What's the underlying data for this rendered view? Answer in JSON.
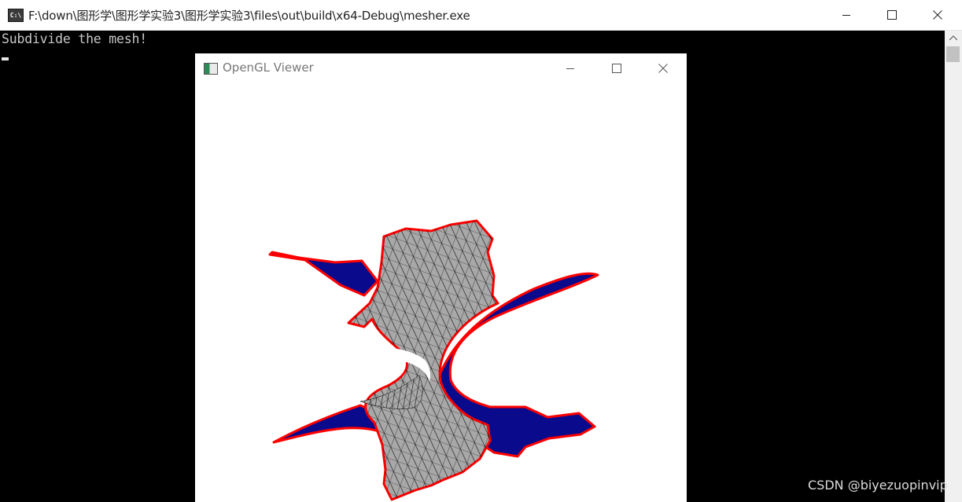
{
  "console": {
    "title": "F:\\down\\图形学\\图形学实验3\\图形学实验3\\files\\out\\build\\x64-Debug\\mesher.exe",
    "icon": "console-app-icon",
    "icon_text": "C:\\",
    "output_line": "Subdivide the mesh!"
  },
  "gl_window": {
    "title": "OpenGL Viewer",
    "icon": "opengl-app-icon",
    "colors": {
      "surface_fill": "#a8a8a8",
      "surface_back": "#0a0a8c",
      "wire": "#000000",
      "boundary": "#ff0000",
      "background": "#ffffff"
    }
  },
  "watermark": "CSDN @biyezuopinvip"
}
